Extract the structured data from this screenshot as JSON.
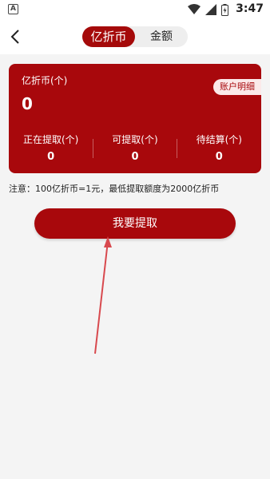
{
  "status_bar": {
    "app_badge": "A",
    "time": "3:47"
  },
  "header": {
    "tabs": [
      {
        "label": "亿折币",
        "active": true
      },
      {
        "label": "金额",
        "active": false
      }
    ]
  },
  "balance_card": {
    "title": "亿折币(个)",
    "total": "0",
    "detail_button": "账户明细",
    "stats": [
      {
        "label": "正在提取(个)",
        "value": "0"
      },
      {
        "label": "可提取(个)",
        "value": "0"
      },
      {
        "label": "待结算(个)",
        "value": "0"
      }
    ]
  },
  "notice": "注意：100亿折币=1元，最低提取额度为2000亿折币",
  "withdraw_button": "我要提取",
  "colors": {
    "primary": "#a8080c",
    "background": "#f4f4f4",
    "annotation_arrow": "#d8494e"
  }
}
